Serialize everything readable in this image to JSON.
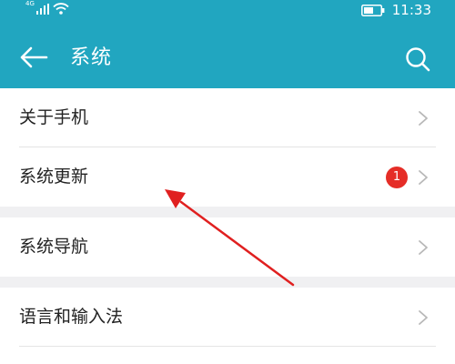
{
  "status_bar": {
    "network_label": "4G",
    "time": "11:33",
    "icons": [
      "signal-icon",
      "wifi-icon",
      "battery-icon"
    ]
  },
  "app_bar": {
    "title": "系统",
    "icons": [
      "back-arrow-icon",
      "search-icon"
    ],
    "background": "#21a6c0"
  },
  "settings": {
    "items": [
      {
        "label": "关于手机"
      },
      {
        "label": "系统更新",
        "badge": "1"
      },
      {
        "label": "系统导航"
      },
      {
        "label": "语言和输入法"
      }
    ]
  },
  "annotation": {
    "color": "#e02020",
    "icon": "red-arrow-annotation"
  }
}
